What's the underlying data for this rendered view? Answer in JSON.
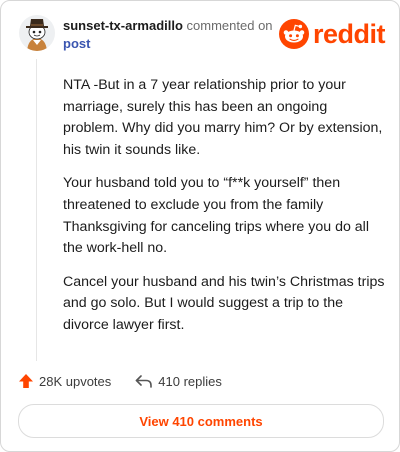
{
  "comment": {
    "username": "sunset-tx-armadillo",
    "commented_on": "commented on",
    "post_link": "post",
    "paragraphs": [
      "NTA -But in a 7 year relationship prior to your marriage, surely this has been an ongoing problem. Why did you marry him? Or by extension, his twin it sounds like.",
      "Your husband told you to “f**k yourself” then threatened to exclude you from the family Thanksgiving for canceling trips where you do all the work-hell no.",
      "Cancel your husband and his twin’s Christmas trips and go solo. But I would suggest a trip to the divorce lawyer first."
    ]
  },
  "brand": {
    "wordmark": "reddit",
    "color": "#ff4500"
  },
  "actions": {
    "upvotes": "28K upvotes",
    "replies": "410 replies"
  },
  "footer": {
    "view_comments": "View 410 comments"
  },
  "icons": {
    "avatar": "snoo-avatar-icon",
    "logo": "reddit-snoo-icon",
    "upvote": "upvote-arrow-icon",
    "reply": "reply-arrow-icon"
  }
}
